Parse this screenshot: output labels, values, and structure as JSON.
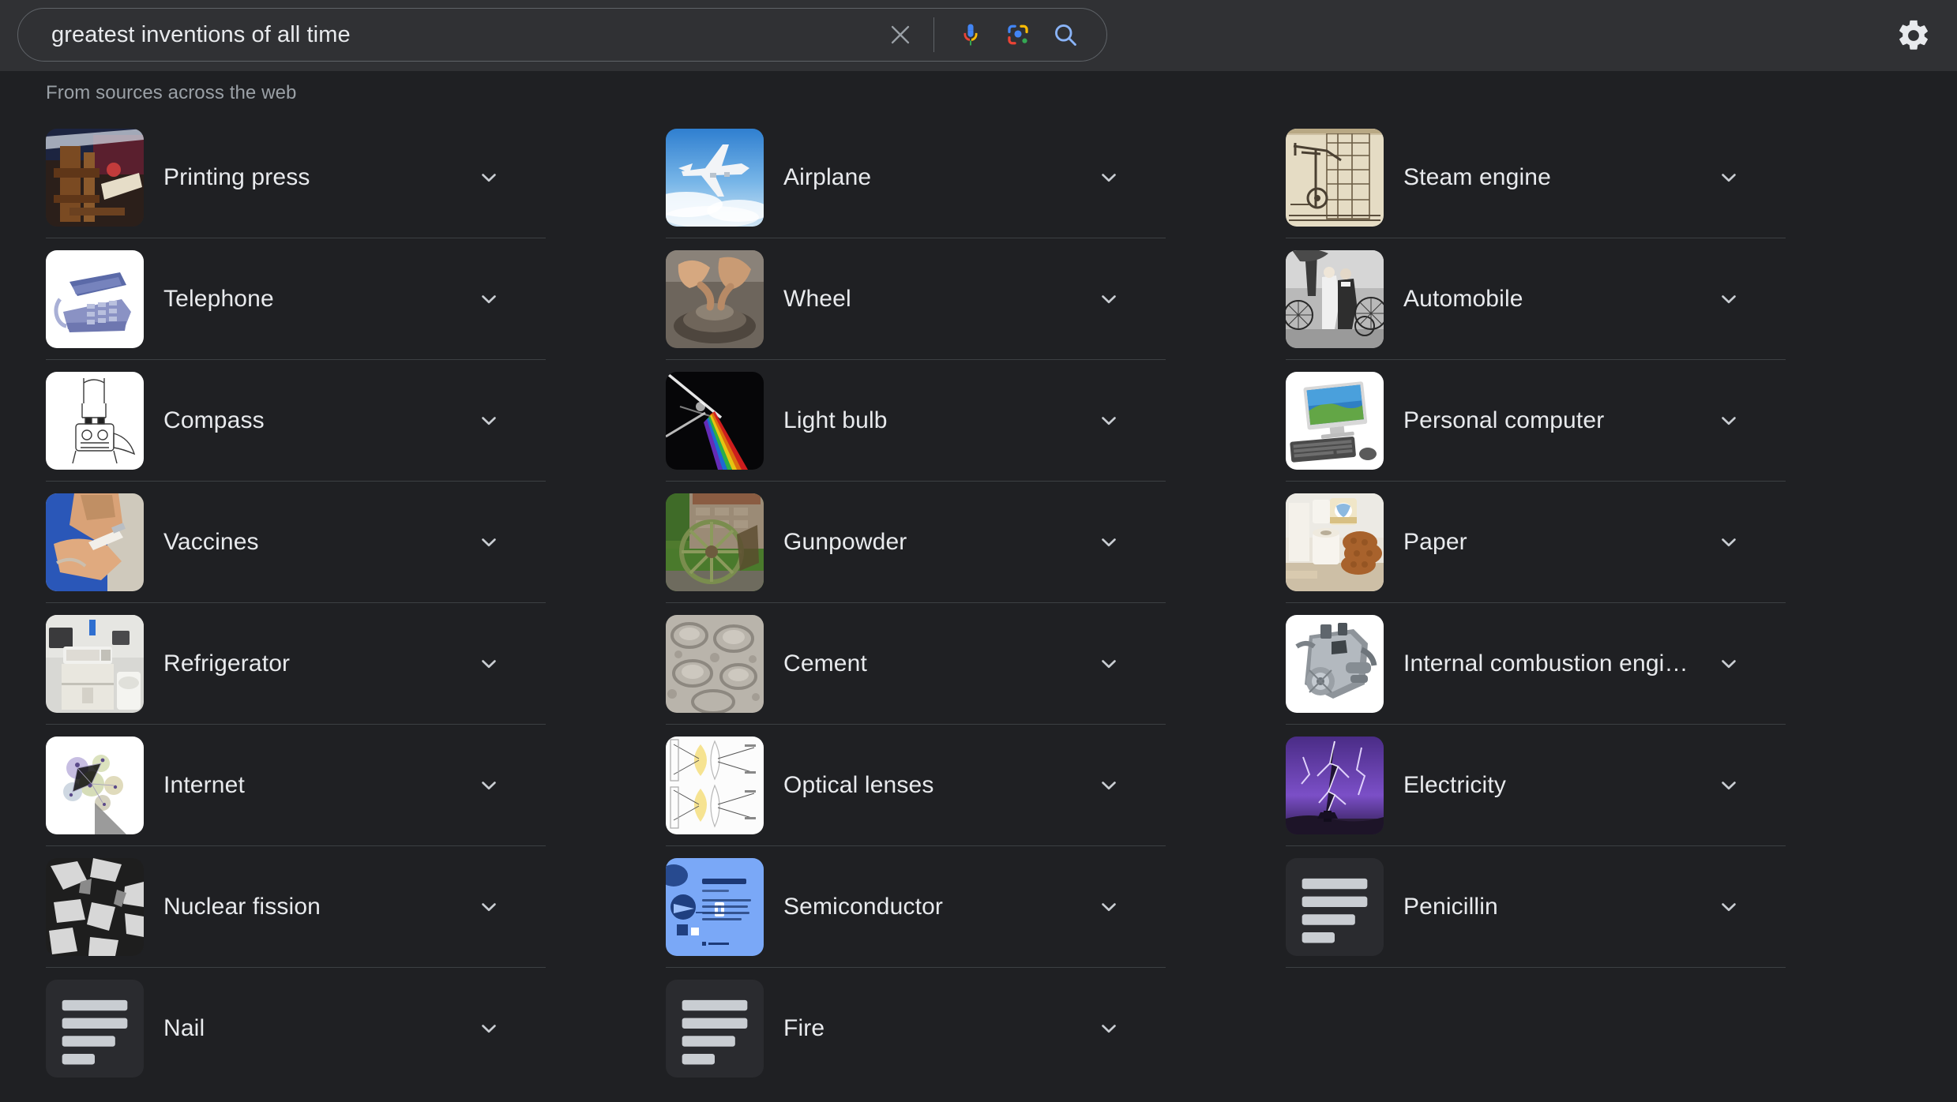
{
  "header": {
    "search": {
      "value": "greatest inventions of all time",
      "placeholder": "Search",
      "clear_icon": "close-icon",
      "voice_icon": "microphone-icon",
      "lens_icon": "google-lens-icon",
      "submit_icon": "search-icon"
    },
    "settings_icon": "gear-icon",
    "background": "#303134"
  },
  "page": {
    "source_note": "From sources across the web",
    "background": "#1f2023",
    "text_color": "#e8eaed",
    "muted_color": "#9aa0a6",
    "divider_color": "#3c4043"
  },
  "columns": [
    {
      "items": [
        {
          "label": "Printing press",
          "thumb": "printing-press-photo",
          "chevron": "chevron-down-icon",
          "has_image": true,
          "divider": true
        },
        {
          "label": "Telephone",
          "thumb": "telephone-photo",
          "chevron": "chevron-down-icon",
          "has_image": true,
          "divider": true
        },
        {
          "label": "Compass",
          "thumb": "compass-drawing",
          "chevron": "chevron-down-icon",
          "has_image": true,
          "divider": true
        },
        {
          "label": "Vaccines",
          "thumb": "vaccination-photo",
          "chevron": "chevron-down-icon",
          "has_image": true,
          "divider": true
        },
        {
          "label": "Refrigerator",
          "thumb": "refrigerator-photo",
          "chevron": "chevron-down-icon",
          "has_image": true,
          "divider": true
        },
        {
          "label": "Internet",
          "thumb": "internet-map-photo",
          "chevron": "chevron-down-icon",
          "has_image": true,
          "divider": true
        },
        {
          "label": "Nuclear fission",
          "thumb": "nuclear-fission-photo",
          "chevron": "chevron-down-icon",
          "has_image": true,
          "divider": true
        },
        {
          "label": "Nail",
          "thumb": "text-lines-icon",
          "chevron": "chevron-down-icon",
          "has_image": false,
          "divider": false
        }
      ]
    },
    {
      "items": [
        {
          "label": "Airplane",
          "thumb": "airplane-photo",
          "chevron": "chevron-down-icon",
          "has_image": true,
          "divider": true
        },
        {
          "label": "Wheel",
          "thumb": "potters-wheel-photo",
          "chevron": "chevron-down-icon",
          "has_image": true,
          "divider": true
        },
        {
          "label": "Light bulb",
          "thumb": "prism-light-photo",
          "chevron": "chevron-down-icon",
          "has_image": true,
          "divider": true
        },
        {
          "label": "Gunpowder",
          "thumb": "water-wheel-photo",
          "chevron": "chevron-down-icon",
          "has_image": true,
          "divider": true
        },
        {
          "label": "Cement",
          "thumb": "cement-texture-photo",
          "chevron": "chevron-down-icon",
          "has_image": true,
          "divider": true
        },
        {
          "label": "Optical lenses",
          "thumb": "optical-lens-diagram",
          "chevron": "chevron-down-icon",
          "has_image": true,
          "divider": true
        },
        {
          "label": "Semiconductor",
          "thumb": "semiconductor-card",
          "chevron": "chevron-down-icon",
          "has_image": true,
          "divider": true
        },
        {
          "label": "Fire",
          "thumb": "text-lines-icon",
          "chevron": "chevron-down-icon",
          "has_image": false,
          "divider": false
        }
      ]
    },
    {
      "items": [
        {
          "label": "Steam engine",
          "thumb": "steam-engine-drawing",
          "chevron": "chevron-down-icon",
          "has_image": true,
          "divider": true
        },
        {
          "label": "Automobile",
          "thumb": "early-automobile-photo",
          "chevron": "chevron-down-icon",
          "has_image": true,
          "divider": true
        },
        {
          "label": "Personal computer",
          "thumb": "desktop-computer-photo",
          "chevron": "chevron-down-icon",
          "has_image": true,
          "divider": true
        },
        {
          "label": "Paper",
          "thumb": "paper-rolls-photo",
          "chevron": "chevron-down-icon",
          "has_image": true,
          "divider": true
        },
        {
          "label": "Internal combustion engi…",
          "thumb": "engine-photo",
          "chevron": "chevron-down-icon",
          "has_image": true,
          "divider": true
        },
        {
          "label": "Electricity",
          "thumb": "lightning-photo",
          "chevron": "chevron-down-icon",
          "has_image": true,
          "divider": true
        },
        {
          "label": "Penicillin",
          "thumb": "text-lines-icon",
          "chevron": "chevron-down-icon",
          "has_image": false,
          "divider": true
        }
      ]
    }
  ]
}
